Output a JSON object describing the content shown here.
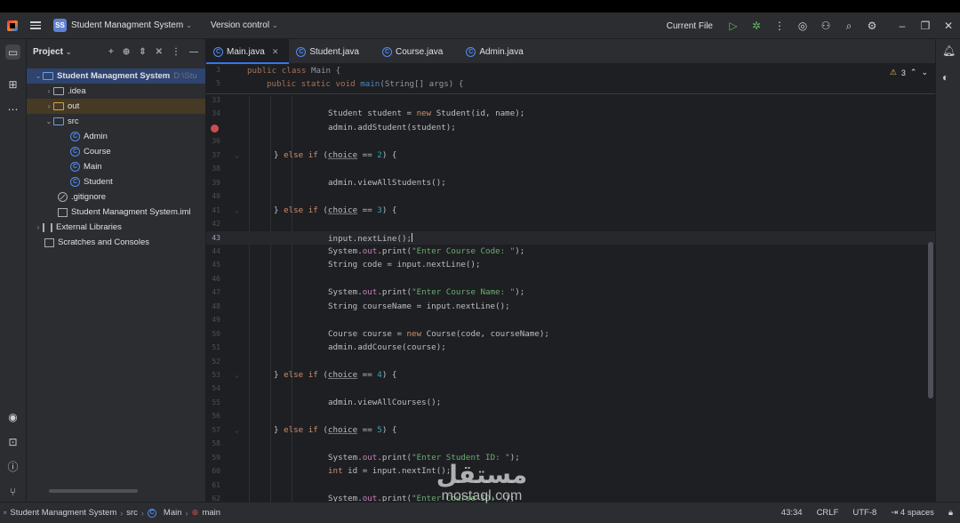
{
  "topbar": {
    "project_badge": "SS",
    "project_name": "Student Managment System",
    "version_control": "Version control",
    "run_config": "Current File"
  },
  "project_panel": {
    "title": "Project",
    "tree": [
      {
        "label": "Student Managment System",
        "suffix": "D:\\Stu",
        "type": "root"
      },
      {
        "label": ".idea",
        "type": "folder"
      },
      {
        "label": "out",
        "type": "folder-out"
      },
      {
        "label": "src",
        "type": "folder-src"
      },
      {
        "label": "Admin",
        "type": "class"
      },
      {
        "label": "Course",
        "type": "class"
      },
      {
        "label": "Main",
        "type": "class"
      },
      {
        "label": "Student",
        "type": "class"
      },
      {
        "label": ".gitignore",
        "type": "git"
      },
      {
        "label": "Student Managment System.iml",
        "type": "iml"
      },
      {
        "label": "External Libraries",
        "type": "lib"
      },
      {
        "label": "Scratches and Consoles",
        "type": "scratch"
      }
    ]
  },
  "tabs": [
    {
      "label": "Main.java",
      "active": true
    },
    {
      "label": "Student.java"
    },
    {
      "label": "Course.java"
    },
    {
      "label": "Admin.java"
    }
  ],
  "editor": {
    "warnings_count": "3",
    "sticky_lines": [
      {
        "ln": "3",
        "code": "public class Main {"
      },
      {
        "ln": "5",
        "code": "    public static void main(String[] args) {"
      }
    ],
    "lines": [
      {
        "ln": "33",
        "code": ""
      },
      {
        "ln": "34",
        "code": "Student student = new Student(id, name);"
      },
      {
        "ln": "35",
        "code": "admin.addStudent(student);"
      },
      {
        "ln": "36",
        "code": ""
      },
      {
        "ln": "37",
        "code": "} else if (choice == 2) {"
      },
      {
        "ln": "38",
        "code": ""
      },
      {
        "ln": "39",
        "code": "admin.viewAllStudents();"
      },
      {
        "ln": "40",
        "code": ""
      },
      {
        "ln": "41",
        "code": "} else if (choice == 3) {"
      },
      {
        "ln": "42",
        "code": ""
      },
      {
        "ln": "43",
        "code": "input.nextLine();"
      },
      {
        "ln": "44",
        "code": "System.out.print(\"Enter Course Code: \");"
      },
      {
        "ln": "45",
        "code": "String code = input.nextLine();"
      },
      {
        "ln": "46",
        "code": ""
      },
      {
        "ln": "47",
        "code": "System.out.print(\"Enter Course Name: \");"
      },
      {
        "ln": "48",
        "code": "String courseName = input.nextLine();"
      },
      {
        "ln": "49",
        "code": ""
      },
      {
        "ln": "50",
        "code": "Course course = new Course(code, courseName);"
      },
      {
        "ln": "51",
        "code": "admin.addCourse(course);"
      },
      {
        "ln": "52",
        "code": ""
      },
      {
        "ln": "53",
        "code": "} else if (choice == 4) {"
      },
      {
        "ln": "54",
        "code": ""
      },
      {
        "ln": "55",
        "code": "admin.viewAllCourses();"
      },
      {
        "ln": "56",
        "code": ""
      },
      {
        "ln": "57",
        "code": "} else if (choice == 5) {"
      },
      {
        "ln": "58",
        "code": ""
      },
      {
        "ln": "59",
        "code": "System.out.print(\"Enter Student ID: \");"
      },
      {
        "ln": "60",
        "code": "int id = input.nextInt();"
      },
      {
        "ln": "61",
        "code": ""
      },
      {
        "ln": "62",
        "code": "System.out.print(\"Enter Course ID: \");"
      }
    ]
  },
  "statusbar": {
    "crumbs": [
      "Student Managment System",
      "src",
      "Main",
      "main"
    ],
    "position": "43:34",
    "line_sep": "CRLF",
    "encoding": "UTF-8",
    "indent": "4 spaces"
  },
  "watermark": {
    "arabic": "مستقل",
    "latin": "mostaql.com"
  }
}
